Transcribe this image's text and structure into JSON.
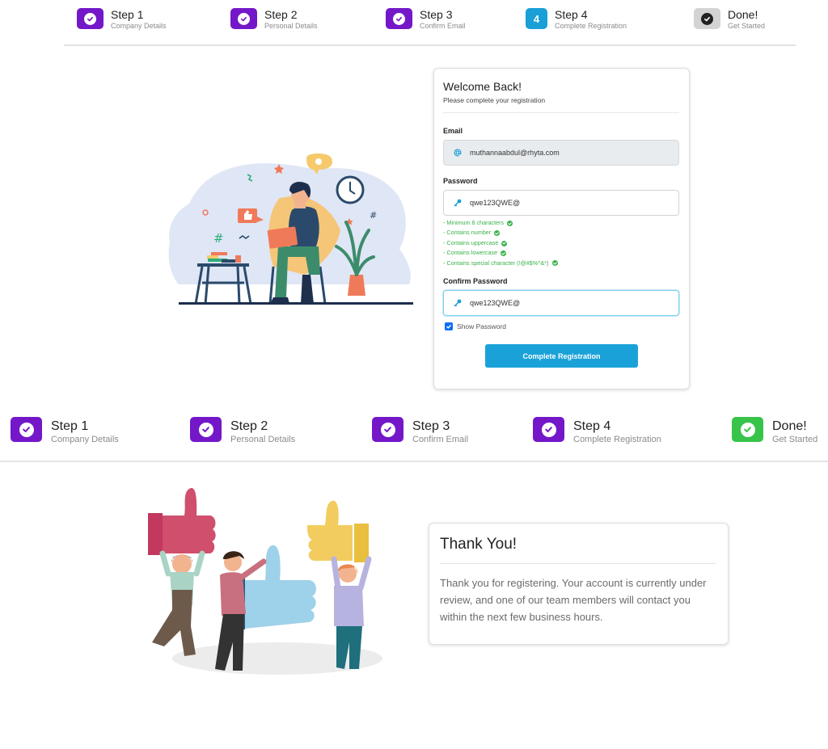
{
  "stepper_top": {
    "steps": [
      {
        "title": "Step 1",
        "subtitle": "Company Details",
        "state": "completed"
      },
      {
        "title": "Step 2",
        "subtitle": "Personal Details",
        "state": "completed"
      },
      {
        "title": "Step 3",
        "subtitle": "Confirm Email",
        "state": "completed"
      },
      {
        "title": "Step 4",
        "subtitle": "Complete Registration",
        "state": "active",
        "number": "4"
      },
      {
        "title": "Done!",
        "subtitle": "Get Started",
        "state": "pending"
      }
    ]
  },
  "stepper_bottom": {
    "steps": [
      {
        "title": "Step 1",
        "subtitle": "Company Details",
        "state": "completed"
      },
      {
        "title": "Step 2",
        "subtitle": "Personal Details",
        "state": "completed"
      },
      {
        "title": "Step 3",
        "subtitle": "Confirm Email",
        "state": "completed"
      },
      {
        "title": "Step 4",
        "subtitle": "Complete Registration",
        "state": "completed"
      },
      {
        "title": "Done!",
        "subtitle": "Get Started",
        "state": "completed"
      }
    ]
  },
  "registration_form": {
    "title": "Welcome Back!",
    "subtitle": "Please complete your registration",
    "email_label": "Email",
    "email_value": "muthannaabdul@rhyta.com",
    "password_label": "Password",
    "password_value": "qwe123QWE@",
    "password_rules": [
      "- Minimum 8 characters",
      "- Contains number",
      "- Contains uppercase",
      "- Contains lowercase",
      "- Contains special character (!@#$%^&*)"
    ],
    "confirm_label": "Confirm Password",
    "confirm_value": "qwe123QWE@",
    "show_password_label": "Show Password",
    "show_password_checked": true,
    "submit_label": "Complete Registration"
  },
  "thank_you": {
    "title": "Thank You!",
    "message": "Thank you for registering. Your account is currently under review, and one of our team members will contact you within the next few business hours."
  },
  "icons": {
    "step_completed": "check-circle-icon",
    "email_field": "at-sign-icon",
    "password_field": "key-icon",
    "rule_ok": "check-circle-icon"
  },
  "colors": {
    "step_completed": "#7417c9",
    "step_active": "#1a9fd6",
    "step_pending": "#d3d3d3",
    "step_done": "#38c44a",
    "primary_button": "#1aa2d8",
    "rule_ok": "#3ab24a"
  }
}
